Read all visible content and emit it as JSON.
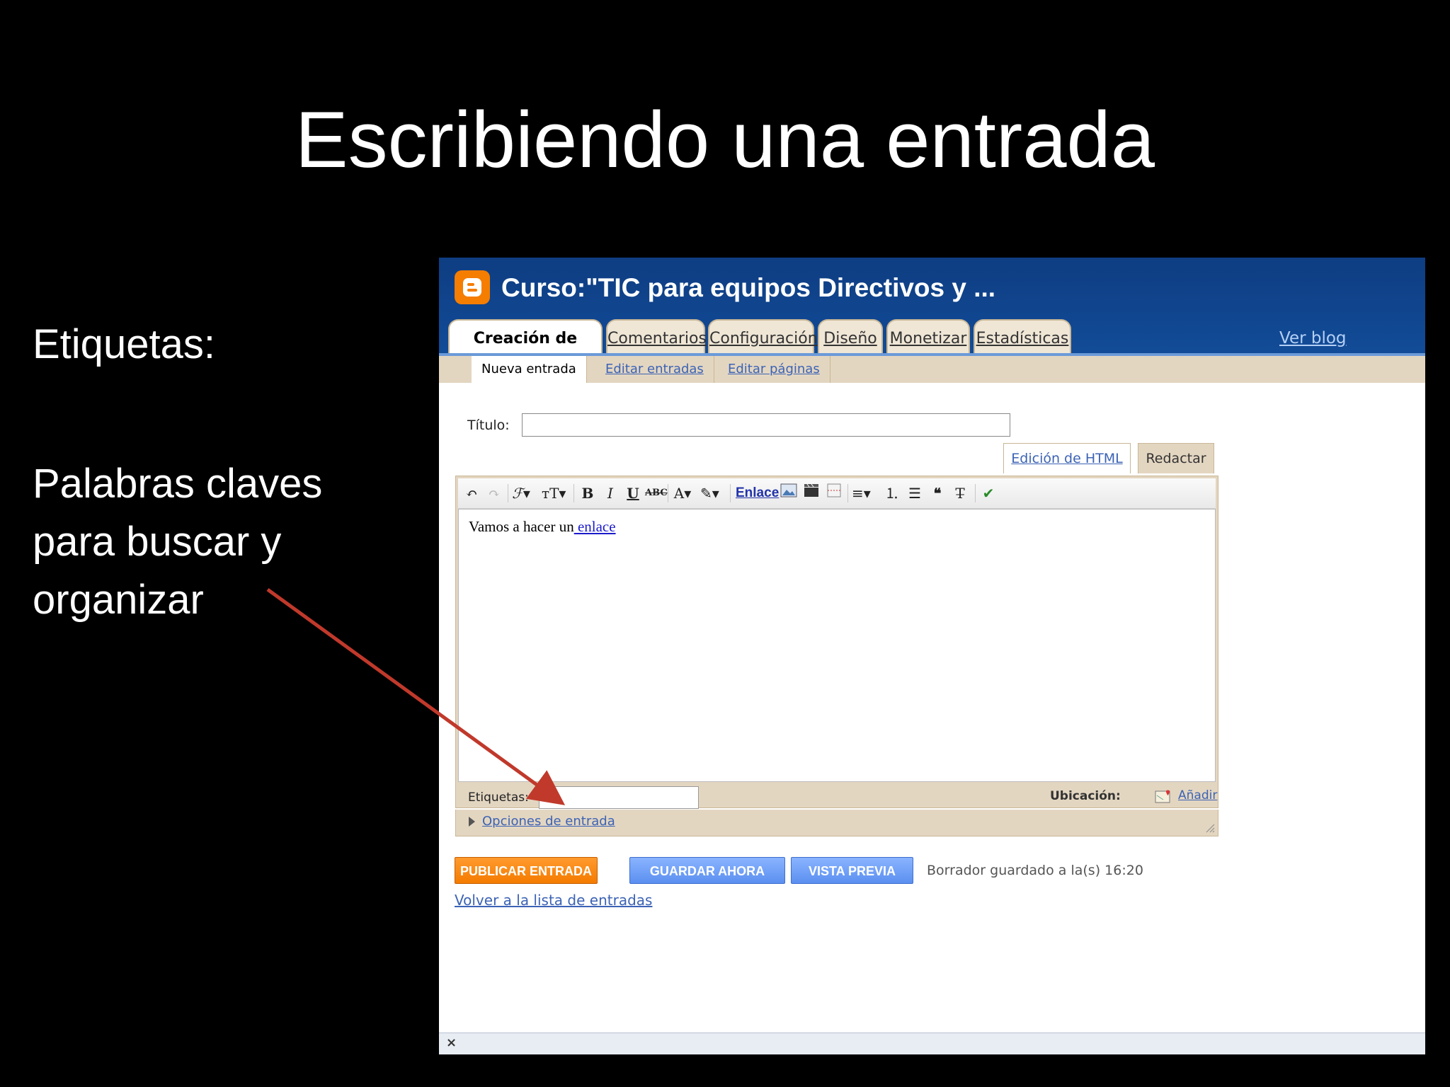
{
  "slide": {
    "title": "Escribiendo una entrada",
    "label": "Etiquetas:",
    "description": "Palabras claves para buscar y organizar"
  },
  "blog": {
    "title": "Curso:\"TIC para equipos Directivos y ...",
    "tabs": [
      "Creación de entradas",
      "Comentarios",
      "Configuración",
      "Diseño",
      "Monetizar",
      "Estadísticas"
    ],
    "view_blog": "Ver blog",
    "subtabs": [
      "Nueva entrada",
      "Editar entradas",
      "Editar páginas"
    ]
  },
  "form": {
    "title_label": "Título:",
    "title_value": "",
    "mode_html": "Edición de HTML",
    "mode_compose": "Redactar",
    "toolbar_link": "Enlace",
    "body_text": "Vamos a hacer un",
    "body_link": " enlace",
    "labels_label": "Etiquetas:",
    "labels_value": "",
    "location_label": "Ubicación:",
    "location_add": "Añadir",
    "options_link": "Opciones de entrada"
  },
  "actions": {
    "publish": "PUBLICAR ENTRADA",
    "save": "GUARDAR AHORA",
    "preview": "VISTA PREVIA",
    "saved_status": "Borrador guardado a la(s) 16:20",
    "back": "Volver a la lista de entradas"
  },
  "statusbar": {
    "close": "×"
  },
  "colors": {
    "accent_arrow": "#c0392b",
    "header_blue": "#124c98",
    "publish_orange": "#f47b00",
    "button_blue": "#5b8ff0",
    "panel_tan": "#e3d6c1"
  }
}
